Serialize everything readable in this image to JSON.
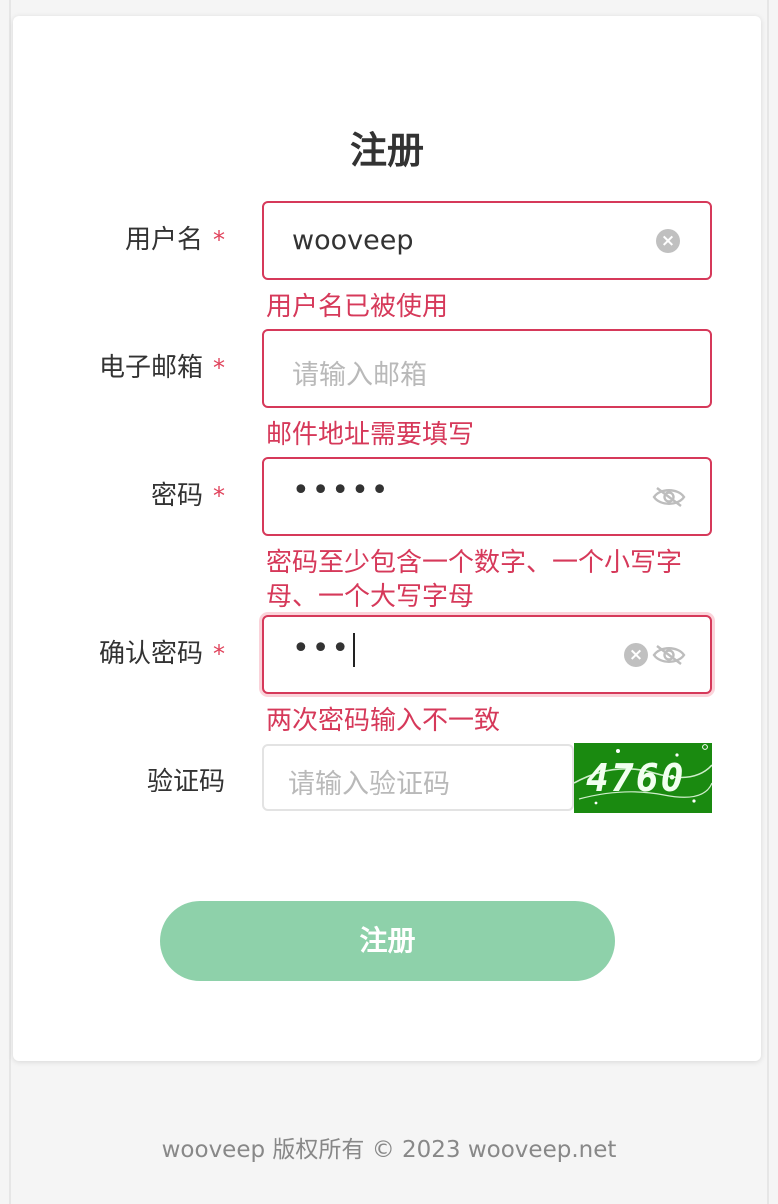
{
  "form": {
    "title": "注册",
    "required_mark": "*",
    "username": {
      "label": "用户名",
      "value": "wooveep",
      "error": "用户名已被使用"
    },
    "email": {
      "label": "电子邮箱",
      "placeholder": "请输入邮箱",
      "error": "邮件地址需要填写"
    },
    "password": {
      "label": "密码",
      "masked_value": "•••••",
      "error": "密码至少包含一个数字、一个小写字母、一个大写字母"
    },
    "confirm_password": {
      "label": "确认密码",
      "masked_value": "•••",
      "error": "两次密码输入不一致"
    },
    "captcha": {
      "label": "验证码",
      "placeholder": "请输入验证码",
      "image_text": "4760"
    },
    "submit_label": "注册"
  },
  "footer": {
    "text": "wooveep 版权所有 © 2023 wooveep.net"
  },
  "colors": {
    "error": "#d6395a",
    "submit": "#8ed1aa",
    "captcha_bg": "#1a8a10"
  }
}
